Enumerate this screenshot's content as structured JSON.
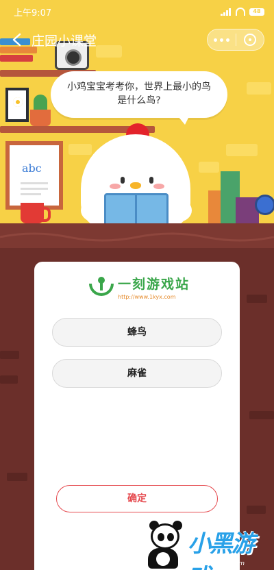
{
  "status_bar": {
    "time": "上午9:07",
    "battery": "48"
  },
  "nav": {
    "title": "庄园小课堂"
  },
  "question": {
    "text": "小鸡宝宝考考你，世界上最小的鸟是什么鸟?"
  },
  "brand": {
    "name": "一刻游戏站",
    "url": "http://www.1kyx.com"
  },
  "answers": {
    "options": [
      "蜂鸟",
      "麻雀"
    ],
    "confirm_label": "确定"
  },
  "board": {
    "letters": "abc"
  },
  "watermark": {
    "title": "小黑游戏",
    "url": "www.xiaohei.com"
  },
  "colors": {
    "scene_bg": "#f7d146",
    "wall_bg": "#6b2f2a",
    "brand_green": "#3aa64a",
    "confirm_red": "#e5484d"
  }
}
